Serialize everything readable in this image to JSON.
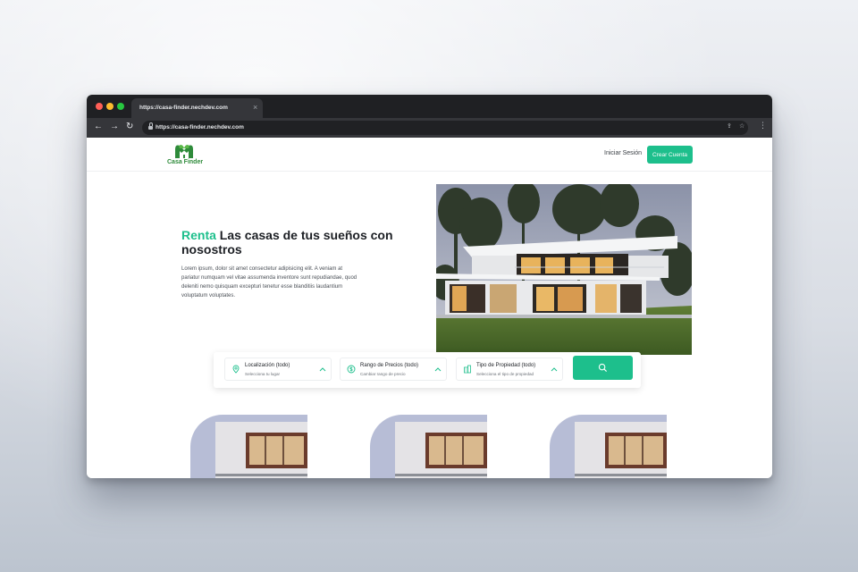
{
  "browser": {
    "tab_title": "https://casa-finder.nechdev.com",
    "tab_close": "×",
    "url": "https://casa-finder.nechdev.com",
    "nav_back": "←",
    "nav_forward": "→",
    "nav_reload": "↻",
    "share_glyph": "⇪",
    "star_glyph": "☆",
    "menu_glyph": "⋮"
  },
  "header": {
    "logo_text": "Casa Finder",
    "login_label": "Iniciar Sesión",
    "signup_label": "Crear Cuenta"
  },
  "hero": {
    "accent": "Renta",
    "title_rest": " Las casas de tus sueños con nosostros",
    "description": "Lorem ipsum, dolor sit amet consectetur adipisicing elit. A veniam at pariatur numquam vel vitae assumenda inventore sunt repudiandae, quod deleniti nemo quisquam excepturi tenetur esse blanditiis laudantium voluptatum voluptates."
  },
  "search": {
    "filters": [
      {
        "title": "Localización (todo)",
        "subtitle": "Selecciona tu lugar",
        "icon": "map-pin-icon"
      },
      {
        "title": "Rango de Precios (todo)",
        "subtitle": "Cambiar rango de precio",
        "icon": "dollar-icon"
      },
      {
        "title": "Tipo de Propiedad (todo)",
        "subtitle": "Selecciona el tipo de propiedad",
        "icon": "building-icon"
      }
    ]
  },
  "colors": {
    "accent": "#1dbf8c",
    "logo_green": "#2e8b3a",
    "tab_bar": "#1f2023",
    "toolbar": "#35363a"
  }
}
